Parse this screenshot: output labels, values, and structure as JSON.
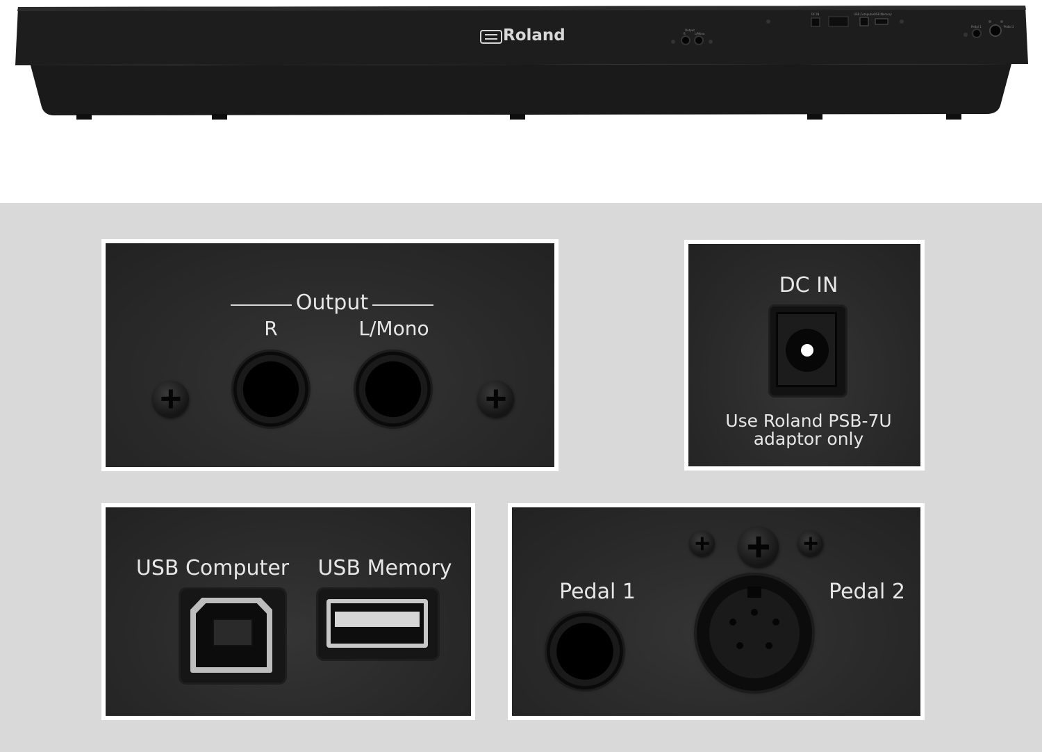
{
  "piano": {
    "brand": "Roland",
    "mini_labels": {
      "output": "Output",
      "r": "R",
      "l_mono": "L/Mono",
      "dc_in": "DC IN",
      "usb_computer": "USB Computer",
      "usb_memory": "USB Memory",
      "pedal1": "Pedal 1",
      "pedal2": "Pedal 2"
    }
  },
  "panels": {
    "output": {
      "title": "Output",
      "left_label": "R",
      "right_label": "L/Mono"
    },
    "dc_in": {
      "title": "DC IN",
      "note_line1": "Use Roland PSB-7U",
      "note_line2": "adaptor only"
    },
    "usb": {
      "computer_label": "USB Computer",
      "memory_label": "USB Memory"
    },
    "pedal": {
      "pedal1_label": "Pedal 1",
      "pedal2_label": "Pedal 2"
    }
  },
  "colors": {
    "panel_bg": "#2b2b2b",
    "text": "#e6e6e6",
    "backdrop": "#d9d9d9"
  }
}
